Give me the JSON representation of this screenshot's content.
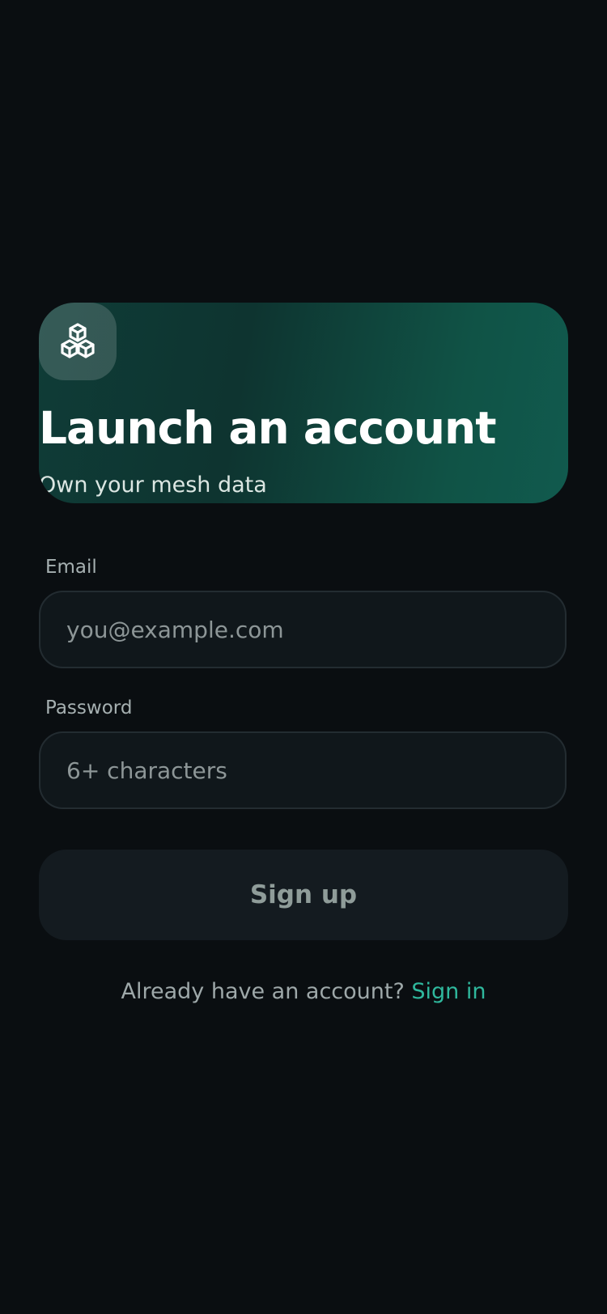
{
  "hero": {
    "icon": "cubes-icon",
    "title": "Launch an account",
    "subtitle": "Own your mesh data"
  },
  "form": {
    "email": {
      "label": "Email",
      "value": "",
      "placeholder": "you@example.com"
    },
    "password": {
      "label": "Password",
      "value": "",
      "placeholder": "6+ characters"
    },
    "submit_label": "Sign up"
  },
  "footer": {
    "prompt": "Already have an account?",
    "link_label": "Sign in"
  },
  "colors": {
    "background": "#0a0e11",
    "hero_gradient_start": "#0f3c37",
    "hero_gradient_end": "#115a4e",
    "accent": "#2fb89d",
    "field_background": "#10171b",
    "button_background": "#141b20"
  }
}
